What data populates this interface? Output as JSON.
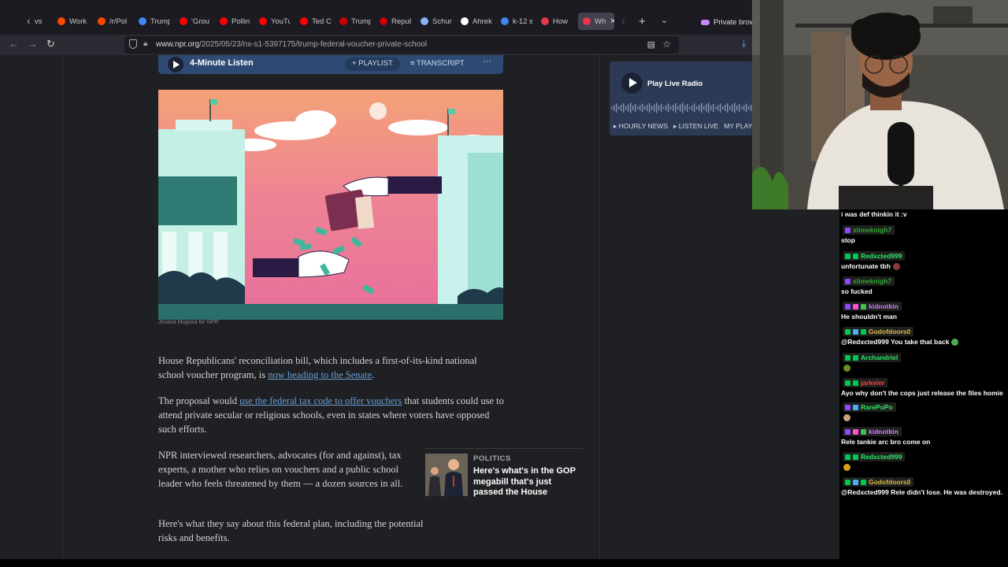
{
  "browser": {
    "tabs": [
      {
        "label": "vs",
        "favicon_color": "#555555"
      },
      {
        "label": "Work",
        "favicon_color": "#ff4500"
      },
      {
        "label": "/r/Pol",
        "favicon_color": "#ff4500"
      },
      {
        "label": "Trump",
        "favicon_color": "#4285f4"
      },
      {
        "label": "'Grou",
        "favicon_color": "#ff0000"
      },
      {
        "label": "Pollin",
        "favicon_color": "#ff0000"
      },
      {
        "label": "YouTu",
        "favicon_color": "#ff0000"
      },
      {
        "label": "Ted C",
        "favicon_color": "#ff0000"
      },
      {
        "label": "Trump",
        "favicon_color": "#cc0000"
      },
      {
        "label": "Repub",
        "favicon_color": "#cc0000"
      },
      {
        "label": "Schun",
        "favicon_color": "#8ab4f8"
      },
      {
        "label": "Ahrek",
        "favicon_color": "#ffffff"
      },
      {
        "label": "k-12 s",
        "favicon_color": "#4285f4"
      },
      {
        "label": "How",
        "favicon_color": "#e8364b"
      },
      {
        "label": "Wh",
        "favicon_color": "#e8364b"
      }
    ],
    "private_label": "Private browsi",
    "url_host": "www.npr.org",
    "url_path": "/2025/05/23/nx-s1-5397175/trump-federal-voucher-private-school"
  },
  "article": {
    "audio": {
      "title": "4-Minute Listen",
      "playlist": "+ PLAYLIST",
      "transcript": "≡ TRANSCRIPT",
      "more": "···"
    },
    "image_credit": "Jovana Mugosa for NPR",
    "p1_a": "House Republicans' reconciliation bill, which includes a first-of-its-kind national school voucher program, is ",
    "p1_link": "now heading to the Senate",
    "p1_b": ".",
    "p2_a": "The proposal would ",
    "p2_link": "use the federal tax code to offer vouchers",
    "p2_b": " that students could use to attend private secular or religious schools, even in states where voters have opposed such efforts.",
    "p3": "NPR interviewed researchers, advocates (for and against), tax experts, a mother who relies on vouchers and a public school leader who feels threatened by them — a dozen sources in all.",
    "p4": "Here's what they say about this federal plan, including the potential risks and benefits.",
    "related": {
      "tag": "POLITICS",
      "title": "Here's what's in the GOP megabill that's just passed the House"
    }
  },
  "radio": {
    "label": "Play Live Radio",
    "links": [
      "▸ HOURLY NEWS",
      "▸ LISTEN LIVE",
      "MY PLAYL"
    ]
  },
  "chat": {
    "messages": [
      {
        "name": "",
        "name_color": "#ffffff",
        "text": "i was def thinkin it :v",
        "badges": []
      },
      {
        "name": "slimeknigh7",
        "name_color": "#2fa82f",
        "text": "stop",
        "badges": [
          "#9147ff"
        ]
      },
      {
        "name": "Redxcted999",
        "name_color": "#2ee66b",
        "text": "unfortunate tbh",
        "badges": [
          "#00c853",
          "#00c853"
        ]
      },
      {
        "name": "slimeknigh7",
        "name_color": "#2fa82f",
        "text": "so fucked",
        "badges": [
          "#9147ff"
        ]
      },
      {
        "name": "kidnotkin",
        "name_color": "#d67bff",
        "text": "He shouldn't man",
        "badges": [
          "#9147ff",
          "#ff4fd8",
          "#40c057"
        ]
      },
      {
        "name": "Godofdoors0",
        "name_color": "#e3b94a",
        "text": "@Redxcted999 You take that back",
        "badges": [
          "#00c853",
          "#4dabf7",
          "#00c853"
        ]
      },
      {
        "name": "Archandriel",
        "name_color": "#2ee66b",
        "text": "",
        "badges": [
          "#00c853",
          "#00c853"
        ]
      },
      {
        "name": "jarkeler",
        "name_color": "#ff3b3b",
        "text": "Ayo why don't the cops just release the files homie",
        "badges": [
          "#00c853",
          "#00c853"
        ]
      },
      {
        "name": "RarePoPo",
        "name_color": "#2ee66b",
        "text": "",
        "badges": [
          "#9147ff",
          "#4dabf7"
        ]
      },
      {
        "name": "kidnotkin",
        "name_color": "#d67bff",
        "text": "Rele tankie arc bro come on",
        "badges": [
          "#9147ff",
          "#ff4fd8",
          "#40c057"
        ]
      },
      {
        "name": "Redxcted999",
        "name_color": "#2ee66b",
        "text": "",
        "badges": [
          "#00c853",
          "#00c853"
        ]
      },
      {
        "name": "Godofdoors0",
        "name_color": "#e3b94a",
        "text": "@Redxcted999 Rele didn't lose. He was destroyed.",
        "badges": [
          "#00c853",
          "#4dabf7",
          "#00c853"
        ]
      }
    ]
  }
}
